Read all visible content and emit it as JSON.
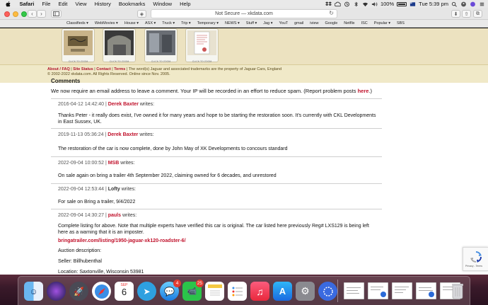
{
  "menubar": {
    "app_name": "Safari",
    "items": [
      "File",
      "Edit",
      "View",
      "History",
      "Bookmarks",
      "Window",
      "Help"
    ],
    "battery": "100%",
    "clock": "Tue 5:39 pm"
  },
  "toolbar": {
    "address_text": "Not Secure — xkdata.com",
    "not_secure": "Not Secure",
    "domain": "xkdata.com"
  },
  "bookmarks": {
    "items": [
      "Classifieds ▾",
      "WebMovies ▾",
      "House ▾",
      "ASX ▾",
      "Truck ▾",
      "Trip ▾",
      "Temporary ▾",
      "NEWS ▾",
      "Stuff ▾",
      "Jag ▾",
      "YouT",
      "gmail",
      "iview",
      "Google",
      "Netflix",
      "ISC",
      "Popular ▾",
      "SBS"
    ]
  },
  "gallery": {
    "thumbs": [
      {
        "caption": "CLICK TO ZOOM"
      },
      {
        "caption": "CLICK TO ZOOM"
      },
      {
        "caption": "CLICK TO ZOOM"
      },
      {
        "caption": "CLICK TO ZOOM"
      }
    ]
  },
  "footer": {
    "links": [
      "About / FAQ",
      "Site Status",
      "Contact",
      "Terms"
    ],
    "trademark": "The word(s) Jaguar and associated trademarks are the property of Jaguar Cars, England",
    "copyright": "© 2002-2022 xkdata.com. All Rights Reserved. Online since Nov. 2005."
  },
  "comments": {
    "section_title": "Comments",
    "intro_text": "We now require an email address to leave a comment. Your IP will be recorded in an effort to reduce spam. (Report problem posts ",
    "intro_link": "here",
    "intro_end": ".)",
    "items": [
      {
        "date": "2016-04-12 14:42:40",
        "author": "Derek Baxter",
        "writes": "writes:",
        "body": "Thanks Peter - it really does exist, I've owned it for many years and hope to be starting the restoration soon. It's currently with CKL Developments in East Sussex, UK."
      },
      {
        "date": "2019-11-13 05:36:24",
        "author": "Derek Baxter",
        "writes": "writes:",
        "body": "The restoration of the car is now complete, done by John May of XK Developments to concours standard"
      },
      {
        "date": "2022-09-04 10:00:52",
        "author": "MSB",
        "writes": "writes:",
        "body": "On sale again on bring a trailer 4th September 2022, claiming owned for 6 decades, and unrestored"
      },
      {
        "date": "2022-09-04 12:53:44",
        "author": "Lofty",
        "writes": "writes:",
        "body": "For sale on Bring a trailer, 9/4/2022"
      },
      {
        "date": "2022-09-04 14:30:27",
        "author": "pauls",
        "writes": "writes:",
        "body": "Complete listing for above. Note that multiple experts have verified this car is original. The car listed here previously Reg# LXS129 is being left here as a warning that it is an imposter.",
        "link": "bringatrailer.com/listing/1950-jaguar-xk120-roadster-6/",
        "extra1": "Auction description:",
        "extra2": "Seller: Billhubenthal",
        "extra3": "Location: Saxtonville, Wisconsin 53981"
      }
    ]
  },
  "recaptcha": {
    "text": "Privacy - Terms"
  },
  "dock": {
    "calendar_month": "SEP",
    "calendar_day": "6",
    "messages_badge": "4",
    "facetime_badge": "25"
  }
}
